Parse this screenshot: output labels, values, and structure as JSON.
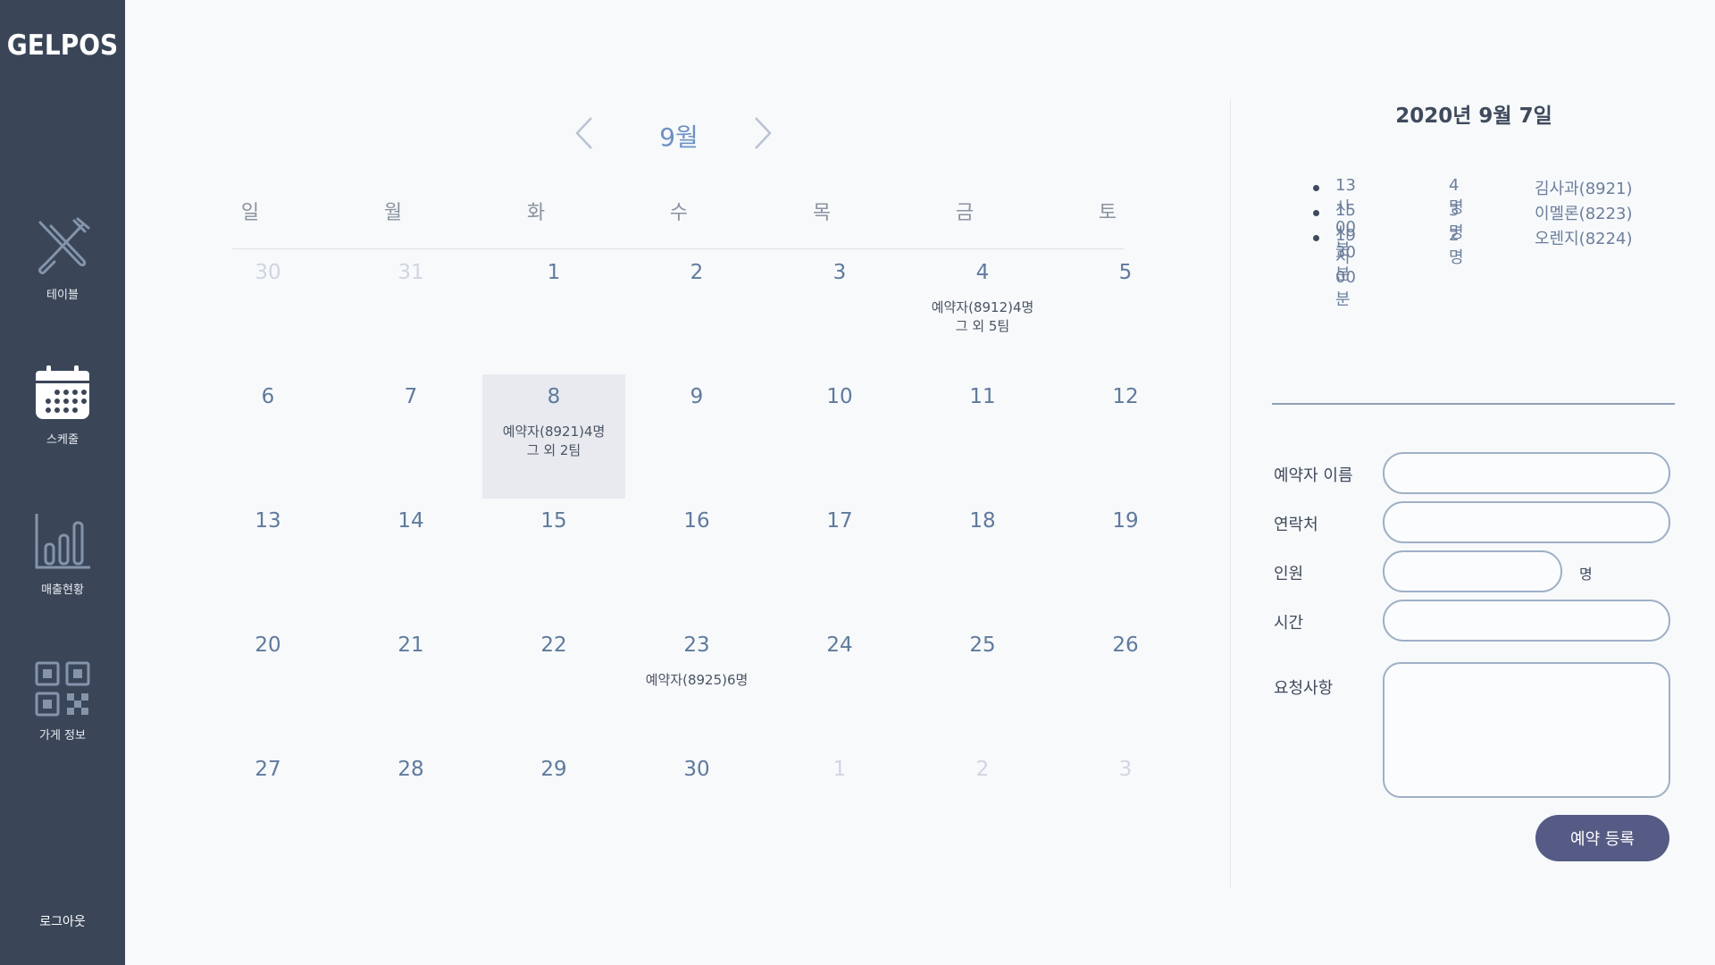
{
  "sidebar": {
    "logo": "GELPOS",
    "items": [
      {
        "label": "테이블"
      },
      {
        "label": "스케줄"
      },
      {
        "label": "매출현황"
      },
      {
        "label": "가게 정보"
      }
    ],
    "logout": "로그아웃"
  },
  "calendar": {
    "month": "9월",
    "weekdays": [
      "일",
      "월",
      "화",
      "수",
      "목",
      "금",
      "토"
    ],
    "weeks": [
      [
        {
          "d": "30",
          "muted": true
        },
        {
          "d": "31",
          "muted": true
        },
        {
          "d": "1"
        },
        {
          "d": "2"
        },
        {
          "d": "3"
        },
        {
          "d": "4",
          "e1": "예약자(8912)4명",
          "e2": "그 외 5팀"
        },
        {
          "d": "5"
        }
      ],
      [
        {
          "d": "6"
        },
        {
          "d": "7"
        },
        {
          "d": "8",
          "selected": true,
          "e1": "예약자(8921)4명",
          "e2": "그 외 2팀"
        },
        {
          "d": "9"
        },
        {
          "d": "10"
        },
        {
          "d": "11"
        },
        {
          "d": "12"
        }
      ],
      [
        {
          "d": "13"
        },
        {
          "d": "14"
        },
        {
          "d": "15"
        },
        {
          "d": "16"
        },
        {
          "d": "17"
        },
        {
          "d": "18"
        },
        {
          "d": "19"
        }
      ],
      [
        {
          "d": "20"
        },
        {
          "d": "21"
        },
        {
          "d": "22"
        },
        {
          "d": "23",
          "e1": "예약자(8925)6명"
        },
        {
          "d": "24"
        },
        {
          "d": "25"
        },
        {
          "d": "26"
        }
      ],
      [
        {
          "d": "27"
        },
        {
          "d": "28"
        },
        {
          "d": "29"
        },
        {
          "d": "30"
        },
        {
          "d": "1",
          "muted": true
        },
        {
          "d": "2",
          "muted": true
        },
        {
          "d": "3",
          "muted": true
        }
      ]
    ]
  },
  "detail": {
    "date": "2020년 9월 7일",
    "reservations": [
      {
        "time": "13시 00분",
        "count": "4명",
        "name": "김사과(8921)"
      },
      {
        "time": "15시 30분",
        "count": "3명",
        "name": "이멜론(8223)"
      },
      {
        "time": "19시 00분",
        "count": "2명",
        "name": "오렌지(8224)"
      }
    ]
  },
  "form": {
    "name_label": "예약자 이름",
    "contact_label": "연락처",
    "people_label": "인원",
    "people_unit": "명",
    "time_label": "시간",
    "request_label": "요청사항",
    "submit": "예약 등록"
  }
}
